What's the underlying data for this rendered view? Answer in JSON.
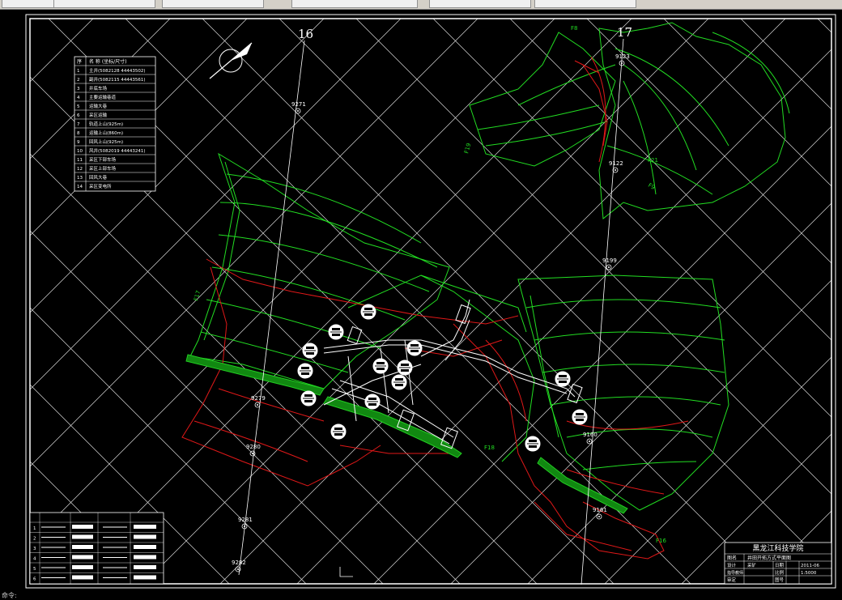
{
  "toolbar": {
    "tabs": [
      "",
      "",
      "",
      "",
      "",
      ""
    ]
  },
  "drawing": {
    "axis_labels": {
      "left": "16",
      "right": "17"
    },
    "boreholes": [
      "9271",
      "9279",
      "9280",
      "9281",
      "9282",
      "9122",
      "9199",
      "9160",
      "9161",
      "9123"
    ],
    "legend_rows": [
      {
        "no": "1",
        "text": "主井(5082128 44443502)"
      },
      {
        "no": "2",
        "text": "副井(5082115 44443561)"
      },
      {
        "no": "3",
        "text": "井底车场"
      },
      {
        "no": "4",
        "text": "主要运输巷道"
      },
      {
        "no": "5",
        "text": "运输大巷"
      },
      {
        "no": "6",
        "text": "采区运输"
      },
      {
        "no": "7",
        "text": "轨道上山(925m)"
      },
      {
        "no": "8",
        "text": "运输上山(860m)"
      },
      {
        "no": "9",
        "text": "回风上山(925m)"
      },
      {
        "no": "10",
        "text": "风井(5082019 44443241)"
      },
      {
        "no": "11",
        "text": "采区下部车场"
      },
      {
        "no": "12",
        "text": "采区上部车场"
      },
      {
        "no": "13",
        "text": "回风大巷"
      },
      {
        "no": "14",
        "text": "采区变电所"
      }
    ],
    "legend_header": [
      "序",
      "名 称 (坐标/尺寸)"
    ],
    "fault_labels": [
      "F17",
      "F18",
      "F9",
      "F21",
      "F19",
      "F16",
      "F8"
    ],
    "title_block": {
      "school": "黑龙江科技学院",
      "row1": [
        "图名",
        "井田开拓方式平面图"
      ],
      "row2": [
        "设计",
        "采矿",
        "日期",
        "2011-06"
      ],
      "row3": [
        "指导教师",
        "",
        "比例",
        "1:5000"
      ],
      "row4": [
        "审定",
        "",
        "图号",
        ""
      ]
    },
    "bottom_legend_rows": [
      "1",
      "2",
      "3",
      "4",
      "5",
      "6"
    ],
    "colors": {
      "green": "#22dd22",
      "red": "#e01818",
      "white": "#ffffff",
      "bg": "#000000"
    }
  },
  "status": {
    "text": "命令:"
  }
}
